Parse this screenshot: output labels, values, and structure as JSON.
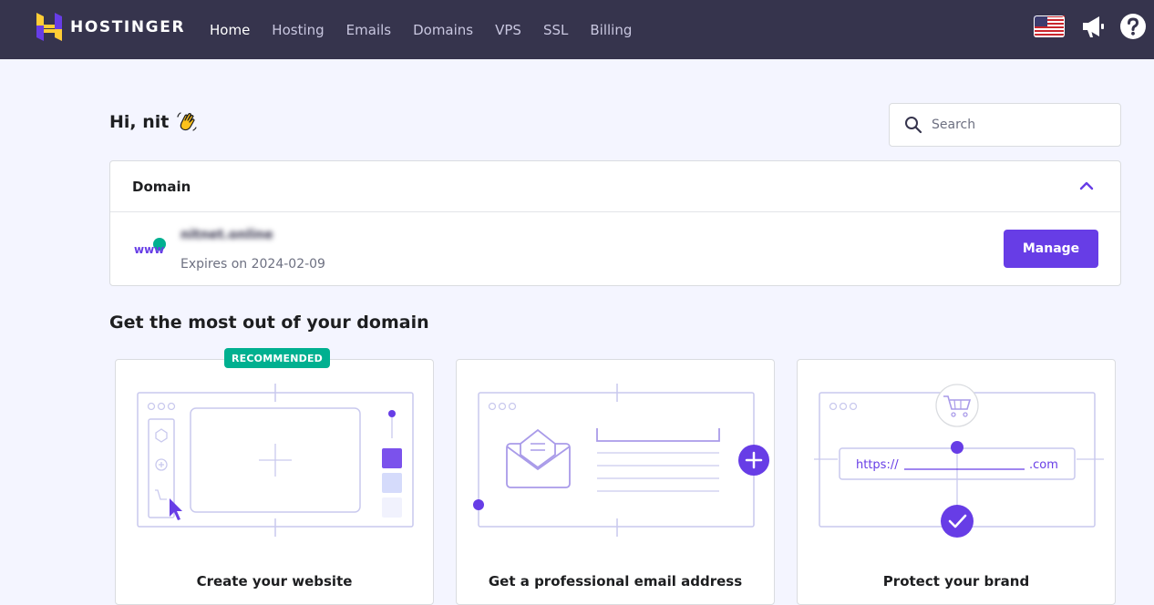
{
  "brand": {
    "name": "HOSTINGER"
  },
  "nav": {
    "items": [
      {
        "label": "Home",
        "active": true
      },
      {
        "label": "Hosting",
        "active": false
      },
      {
        "label": "Emails",
        "active": false
      },
      {
        "label": "Domains",
        "active": false
      },
      {
        "label": "VPS",
        "active": false
      },
      {
        "label": "SSL",
        "active": false
      },
      {
        "label": "Billing",
        "active": false
      }
    ]
  },
  "header": {
    "greeting": "Hi, nit"
  },
  "search": {
    "placeholder": "Search"
  },
  "domain_card": {
    "title": "Domain",
    "domain_name": "nitnet.online",
    "expiry": "Expires on 2024-02-09",
    "manage_label": "Manage"
  },
  "section": {
    "title": "Get the most out of your domain",
    "badge": "RECOMMENDED",
    "cards": [
      {
        "title": "Create your website"
      },
      {
        "title": "Get a professional email address"
      },
      {
        "title": "Protect your brand",
        "url_prefix": "https://",
        "url_suffix": ".com"
      }
    ]
  },
  "colors": {
    "topbar": "#36344d",
    "accent": "#673de6",
    "badge": "#00b090",
    "background": "#f4f5ff"
  }
}
